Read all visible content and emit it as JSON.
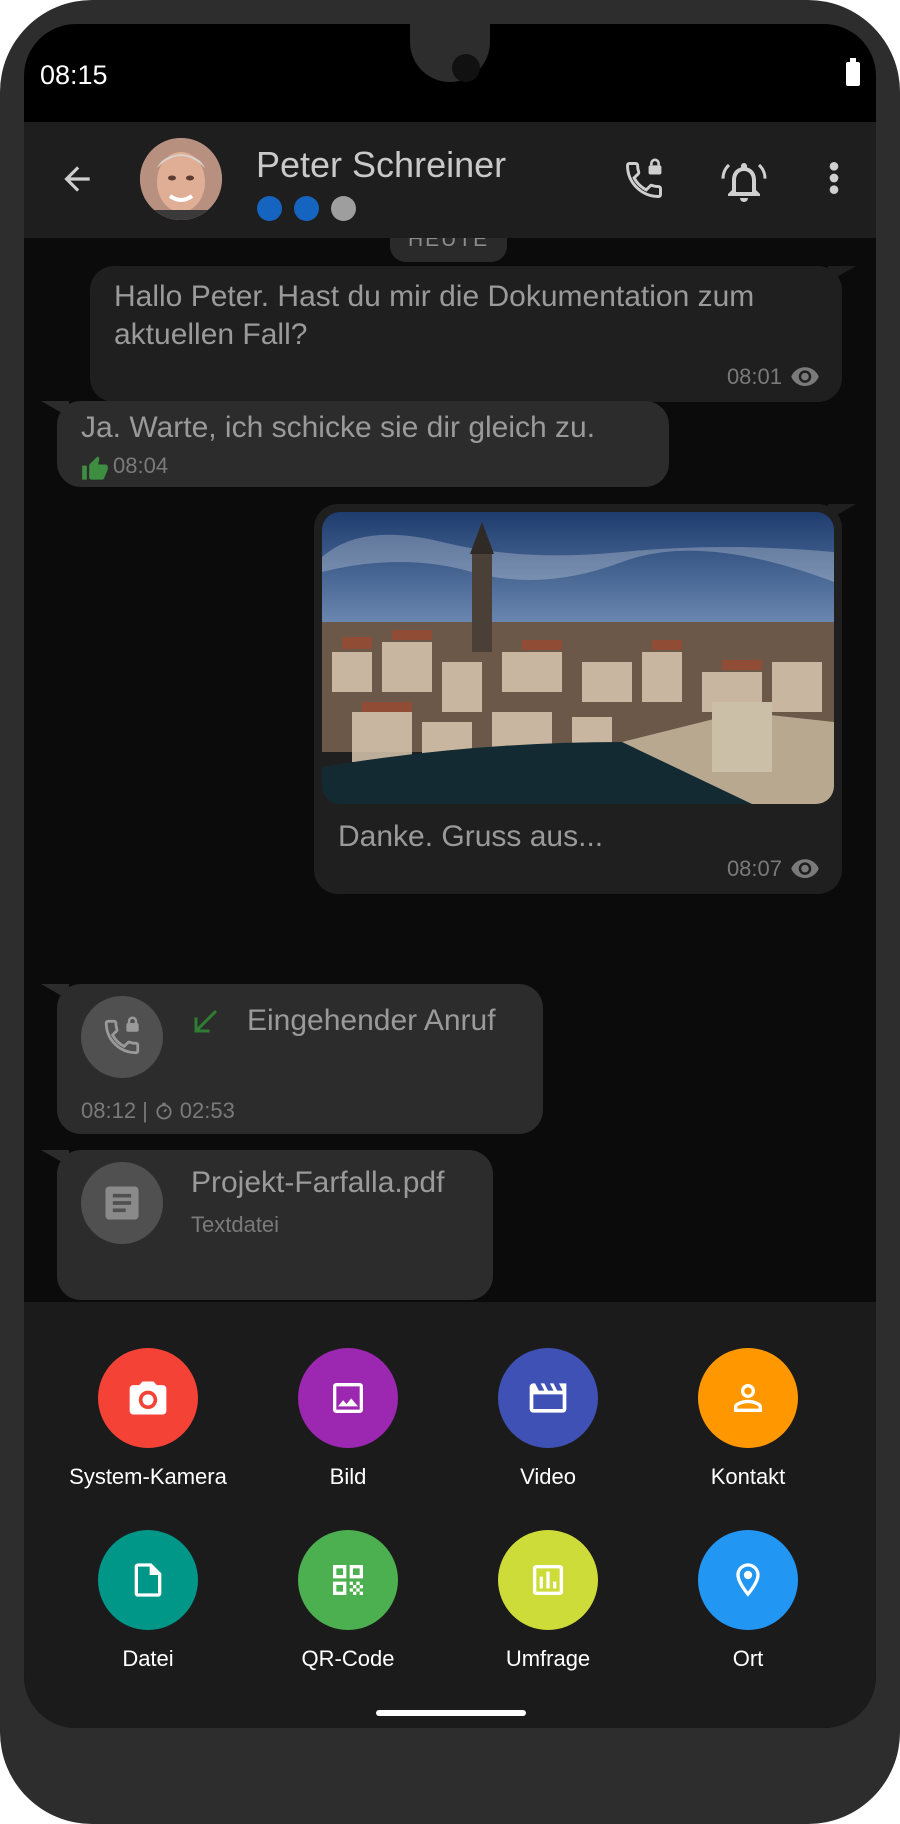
{
  "status_bar": {
    "time": "08:15"
  },
  "header": {
    "contact_name": "Peter Schreiner",
    "trust_dots": [
      "#1565c0",
      "#1565c0",
      "#9e9e9e"
    ]
  },
  "chat": {
    "date_chip": "HEUTE",
    "messages": [
      {
        "direction": "out",
        "text": "Hallo Peter. Hast du mir die Dokumentation zum aktuellen Fall?",
        "time": "08:01"
      },
      {
        "direction": "in",
        "text": "Ja. Warte, ich schicke sie dir gleich zu.",
        "time": "08:04"
      },
      {
        "direction": "out",
        "caption": "Danke. Gruss aus...",
        "time": "08:07"
      },
      {
        "direction": "in",
        "call_label": "Eingehender Anruf",
        "time": "08:12",
        "separator": "|",
        "duration": "02:53"
      },
      {
        "direction": "in",
        "file_name": "Projekt-Farfalla.pdf",
        "file_type": "Textdatei"
      }
    ]
  },
  "attachments": [
    {
      "label": "System-Kamera",
      "icon": "camera-icon",
      "color": "#f44336"
    },
    {
      "label": "Bild",
      "icon": "image-icon",
      "color": "#9c27b0"
    },
    {
      "label": "Video",
      "icon": "video-icon",
      "color": "#3f51b5"
    },
    {
      "label": "Kontakt",
      "icon": "contact-icon",
      "color": "#ff9800"
    },
    {
      "label": "Datei",
      "icon": "file-icon",
      "color": "#009688"
    },
    {
      "label": "QR-Code",
      "icon": "qr-code-icon",
      "color": "#4caf50"
    },
    {
      "label": "Umfrage",
      "icon": "poll-icon",
      "color": "#cddc39"
    },
    {
      "label": "Ort",
      "icon": "location-icon",
      "color": "#2196f3"
    }
  ]
}
